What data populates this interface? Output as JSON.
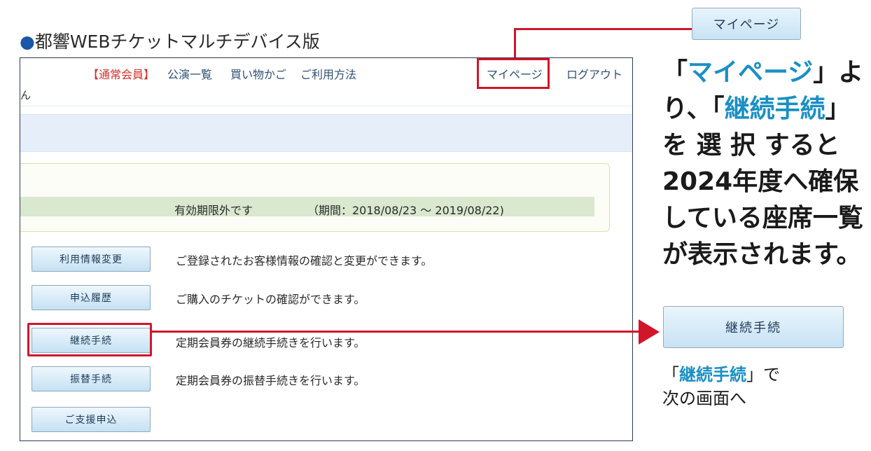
{
  "heading": {
    "bullet": "●",
    "title": "都響WEBチケットマルチデバイス版"
  },
  "mypage_button": {
    "label": "マイページ"
  },
  "nav": {
    "member_type": "【通常会員】",
    "items": [
      "公演一覧",
      "買い物かご",
      "ご利用方法",
      "マイページ",
      "ログアウト"
    ],
    "user_suffix": "ん"
  },
  "status": {
    "text": "有効期限外です",
    "period": "（期間：2018/08/23 ～ 2019/08/22)"
  },
  "menu": [
    {
      "label": "利用情報変更",
      "desc": "ご登録されたお客様情報の確認と変更ができます。"
    },
    {
      "label": "申込履歴",
      "desc": "ご購入のチケットの確認ができます。"
    },
    {
      "label": "継続手続",
      "desc": "定期会員券の継続手続きを行います。"
    },
    {
      "label": "振替手続",
      "desc": "定期会員券の振替手続きを行います。"
    },
    {
      "label": "ご支援申込",
      "desc": ""
    }
  ],
  "explanation": {
    "q_open_1": "「",
    "key1": "マイページ",
    "q_close_1": "」より、「",
    "key2": "継続手続",
    "rest": "」を 選 択 すると2024年度へ確保している座席一覧が表示されます。"
  },
  "continue_button": {
    "label": "継続手続"
  },
  "note": {
    "open": "「",
    "key": "継続手続",
    "close": "」で",
    "line2": "次の画面へ"
  },
  "colors": {
    "accent_red": "#d0162b",
    "teal": "#1a8fc4",
    "brand_blue": "#1b57a8"
  }
}
